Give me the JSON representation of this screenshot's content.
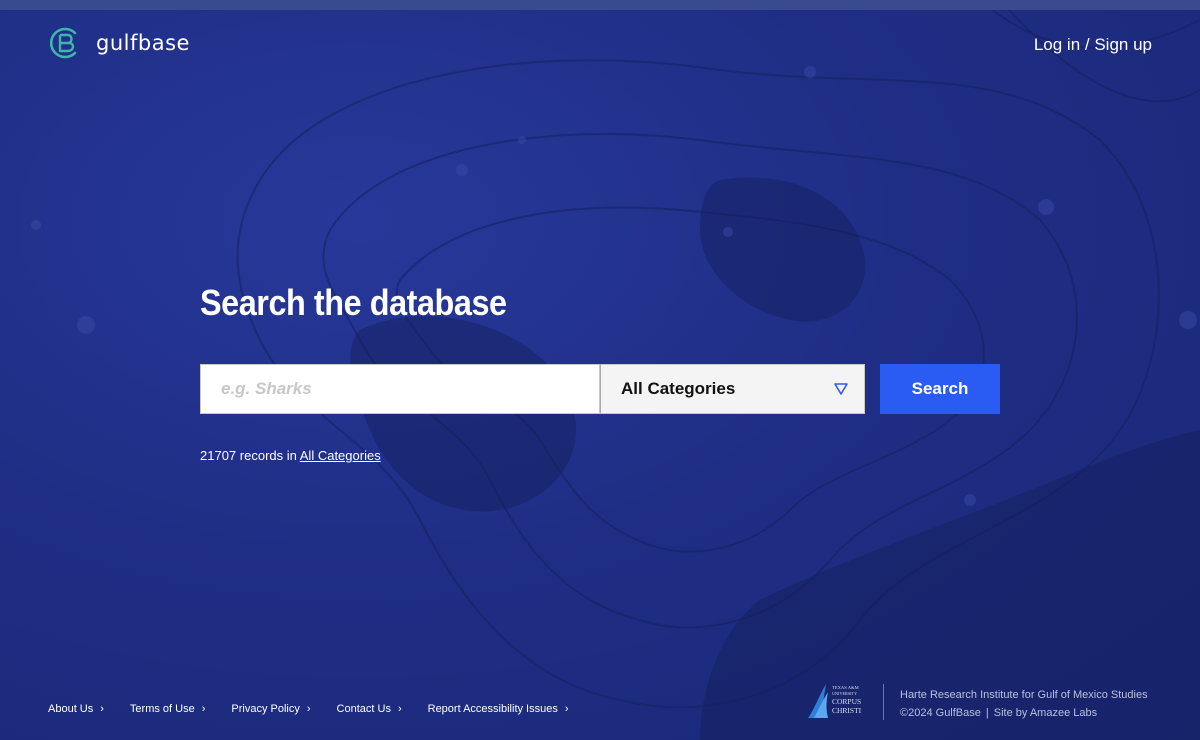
{
  "brand": {
    "name": "gulfbase"
  },
  "header": {
    "auth_link": "Log in / Sign up"
  },
  "search": {
    "title": "Search the database",
    "placeholder": "e.g. Sharks",
    "category_selected": "All Categories",
    "button_label": "Search",
    "records_count": "21707",
    "records_text": "records in",
    "records_category_link": "All Categories"
  },
  "footer": {
    "links": [
      "About Us",
      "Terms of Use",
      "Privacy Policy",
      "Contact Us",
      "Report Accessibility Issues"
    ],
    "institute": "Harte Research Institute for Gulf of Mexico Studies",
    "copyright": "©2024 GulfBase",
    "site_by": "Site by Amazee Labs",
    "university_logo_text": "TEXAS A&M UNIVERSITY CORPUS CHRISTI"
  },
  "colors": {
    "background": "#1f2f86",
    "accent": "#2a5cf3",
    "logo_mark": "#3fb7a8"
  }
}
